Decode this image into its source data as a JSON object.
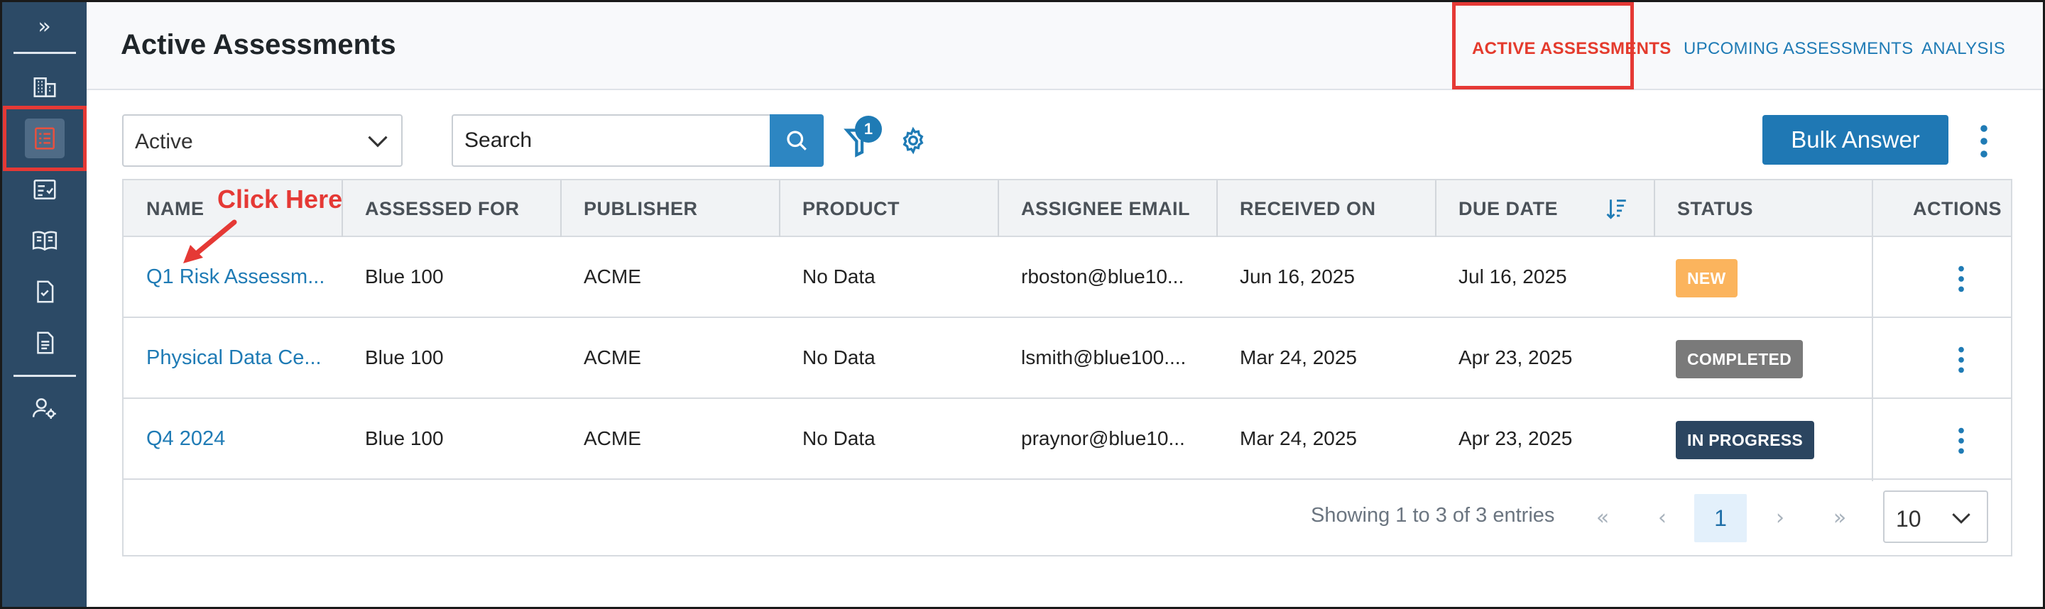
{
  "sidebar": {
    "expand_glyph": "»",
    "items": [
      {
        "name": "building-icon",
        "active": false
      },
      {
        "name": "assessment-list-icon",
        "active": true
      },
      {
        "name": "checklist-icon",
        "active": false
      },
      {
        "name": "open-book-icon",
        "active": false
      },
      {
        "name": "document-check-icon",
        "active": false
      },
      {
        "name": "document-icon",
        "active": false
      },
      {
        "name": "user-settings-icon",
        "active": false
      }
    ]
  },
  "header": {
    "title": "Active Assessments",
    "tabs": [
      {
        "label": "ACTIVE ASSESSMENTS",
        "active": true
      },
      {
        "label": "UPCOMING ASSESSMENTS",
        "active": false
      },
      {
        "label": "ANALYSIS",
        "active": false
      }
    ]
  },
  "toolbar": {
    "status_filter": "Active",
    "search_value": "Search",
    "filter_count": "1",
    "bulk_answer_label": "Bulk Answer"
  },
  "annotation": {
    "text": "Click Here"
  },
  "table": {
    "columns": [
      "NAME",
      "ASSESSED FOR",
      "PUBLISHER",
      "PRODUCT",
      "ASSIGNEE EMAIL",
      "RECEIVED ON",
      "DUE DATE",
      "STATUS",
      "ACTIONS"
    ],
    "rows": [
      {
        "name": "Q1 Risk Assessm...",
        "assessed_for": "Blue 100",
        "publisher": "ACME",
        "product": "No Data",
        "email": "rboston@blue10...",
        "received": "Jun 16, 2025",
        "due": "Jul 16, 2025",
        "status": "NEW"
      },
      {
        "name": "Physical Data Ce...",
        "assessed_for": "Blue 100",
        "publisher": "ACME",
        "product": "No Data",
        "email": "lsmith@blue100....",
        "received": "Mar 24, 2025",
        "due": "Apr 23, 2025",
        "status": "COMPLETED"
      },
      {
        "name": "Q4 2024",
        "assessed_for": "Blue 100",
        "publisher": "ACME",
        "product": "No Data",
        "email": "praynor@blue10...",
        "received": "Mar 24, 2025",
        "due": "Apr 23, 2025",
        "status": "IN PROGRESS"
      }
    ]
  },
  "status_colors": {
    "NEW": "#fbb45d",
    "COMPLETED": "#7a7a7a",
    "IN PROGRESS": "#2b4560"
  },
  "pagination": {
    "summary": "Showing 1 to 3 of 3 entries",
    "first": "«",
    "prev": "‹",
    "current_page": "1",
    "next": "›",
    "last": "»",
    "page_size": "10"
  },
  "colors": {
    "accent": "#1f7bb5",
    "sidebar": "#2c4a66",
    "highlight": "#e53935"
  }
}
